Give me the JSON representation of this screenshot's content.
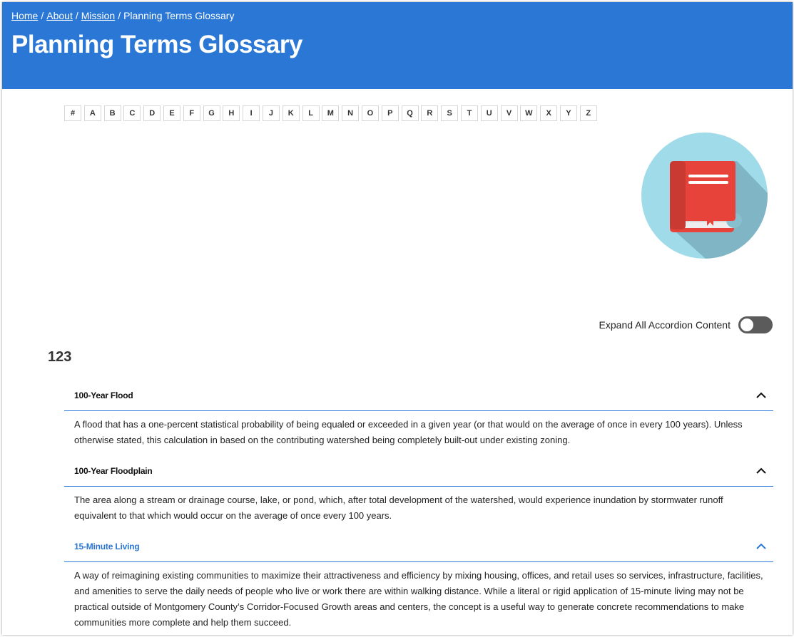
{
  "breadcrumb": {
    "home": "Home",
    "about": "About",
    "mission": "Mission",
    "current": "Planning Terms Glossary",
    "separator": "/"
  },
  "page_title": "Planning Terms Glossary",
  "alphabet": [
    "#",
    "A",
    "B",
    "C",
    "D",
    "E",
    "F",
    "G",
    "H",
    "I",
    "J",
    "K",
    "L",
    "M",
    "N",
    "O",
    "P",
    "Q",
    "R",
    "S",
    "T",
    "U",
    "V",
    "W",
    "X",
    "Y",
    "Z"
  ],
  "expand_toggle": {
    "label": "Expand All Accordion Content",
    "state": "off"
  },
  "section": {
    "heading": "123"
  },
  "terms": [
    {
      "title": "100-Year Flood",
      "definition": "A flood that has a one-percent statistical probability of being equaled or exceeded in a given year (or that would on the average of once in every 100 years). Unless otherwise stated, this calculation in based on the contributing watershed being completely built-out under existing zoning.",
      "expanded": true
    },
    {
      "title": "100-Year Floodplain",
      "definition": "The area along a stream or drainage course, lake, or pond, which, after total development of the watershed, would experience inundation by stormwater runoff equivalent to that which would occur on the average of once every 100 years.",
      "expanded": true
    },
    {
      "title": "15-Minute Living",
      "definition": "A way of reimagining existing communities to maximize their attractiveness and efficiency by mixing housing, offices, and retail uses so services, infrastructure, facilities, and amenities to serve the daily needs of people who live or work there are within walking distance. While a literal or rigid application of 15-minute living may not be practical outside of Montgomery County’s Corridor-Focused Growth areas and centers, the concept is a useful way to generate concrete recommendations to make communities more complete and help them succeed.",
      "expanded": true,
      "active": true
    }
  ],
  "icons": {
    "illustration": "book-icon",
    "collapse": "chevron-up-icon"
  },
  "colors": {
    "header_bg": "#2b77d6",
    "accent": "#2b77d6",
    "illustration_circle": "#9fdbe8",
    "book_red": "#e8433b",
    "toggle_off": "#5b5b5b"
  }
}
